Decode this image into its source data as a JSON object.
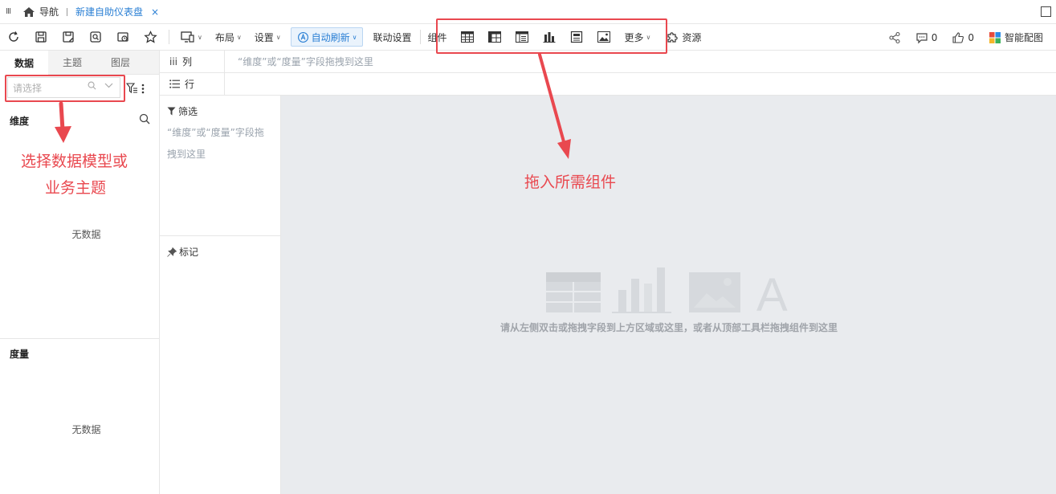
{
  "nav": {
    "menu_glyph": "III",
    "home_label": "导航",
    "tab_label": "新建自助仪表盘",
    "close_glyph": "×"
  },
  "toolbar": {
    "layout_label": "布局",
    "settings_label": "设置",
    "auto_refresh_label": "自动刷新",
    "linkage_label": "联动设置",
    "components_label": "组件",
    "more_label": "更多",
    "resources_label": "资源",
    "comments_count": "0",
    "likes_count": "0",
    "smart_color_label": "智能配图"
  },
  "left_panel": {
    "tabs": [
      {
        "label": "数据",
        "active": true
      },
      {
        "label": "主题",
        "active": false
      },
      {
        "label": "图层",
        "active": false
      }
    ],
    "search_placeholder": "请选择",
    "dimension_title": "维度",
    "measure_title": "度量",
    "dimension_empty": "无数据",
    "measure_empty": "无数据"
  },
  "shelves": {
    "column_label": "列",
    "column_glyph": "iii",
    "row_label": "行",
    "drop_hint": "“维度”或“度量”字段拖拽到这里"
  },
  "filter_panel": {
    "filter_label": "筛选",
    "filter_hint": "“维度”或“度量”字段拖拽到这里",
    "mark_label": "标记"
  },
  "canvas": {
    "placeholder_letter": "A",
    "hint": "请从左侧双击或拖拽字段到上方区域或这里，或者从顶部工具栏拖拽组件到这里"
  },
  "annotations": {
    "left_text_line1": "选择数据模型或",
    "left_text_line2": "业务主题",
    "top_text": "拖入所需组件",
    "color": "#e9484f"
  },
  "colors": {
    "accent": "#2a7fd4",
    "canvas_bg": "#e9ebee",
    "hint_text": "#9aa3ad"
  }
}
